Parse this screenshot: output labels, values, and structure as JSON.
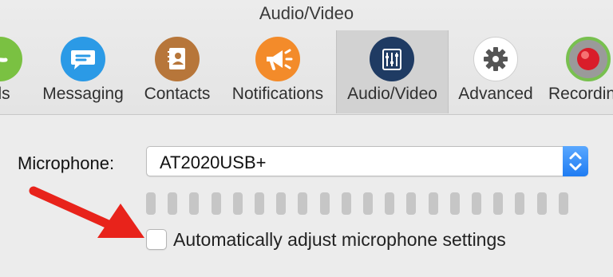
{
  "window": {
    "title": "Audio/Video"
  },
  "tabs": [
    {
      "label": "Calls",
      "icon": "phone-icon",
      "color": "#7ac142",
      "selected": false
    },
    {
      "label": "Messaging",
      "icon": "chat-bubble-icon",
      "color": "#2b9ae6",
      "selected": false
    },
    {
      "label": "Contacts",
      "icon": "address-book-icon",
      "color": "#b7763a",
      "selected": false
    },
    {
      "label": "Notifications",
      "icon": "megaphone-icon",
      "color": "#f38b2a",
      "selected": false
    },
    {
      "label": "Audio/Video",
      "icon": "sliders-icon",
      "color": "#1f3b63",
      "selected": true
    },
    {
      "label": "Advanced",
      "icon": "gear-icon",
      "color": "#ffffff",
      "selected": false
    },
    {
      "label": "Recording",
      "icon": "record-button-icon",
      "color": "#d91d2a",
      "selected": false
    }
  ],
  "microphone": {
    "label": "Microphone:",
    "selected_device": "AT2020USB+"
  },
  "level_meter": {
    "segments": 20,
    "active_segments": 0
  },
  "auto_adjust": {
    "label": "Automatically adjust microphone settings",
    "checked": false
  },
  "annotation": {
    "arrow_color": "#e8231b"
  }
}
